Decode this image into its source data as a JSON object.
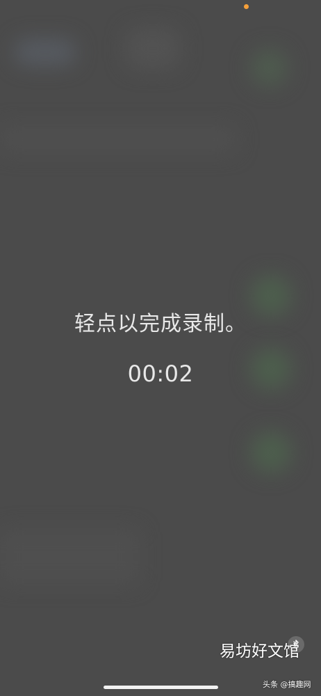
{
  "recording": {
    "instruction": "轻点以完成录制。",
    "elapsed": "00:02"
  },
  "status": {
    "indicator_color": "#f5a03a",
    "indicator": "orange-dot-icon"
  },
  "controls": {
    "bluetooth_icon": "bluetooth-icon"
  },
  "watermark": {
    "main": "易坊好文馆",
    "sub": "头条 @搞趣网"
  }
}
